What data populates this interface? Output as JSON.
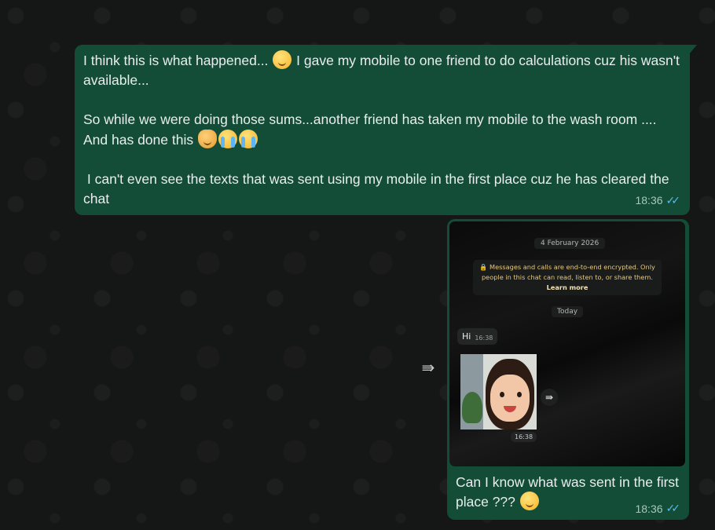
{
  "messages": [
    {
      "id": "msg1",
      "paragraphs": [
        "I think this is what happened... ",
        " I gave my mobile to one friend to do calculations cuz his wasn't available...",
        "So while we were doing those sums...another friend has taken my mobile to the wash room .... And has done this ",
        " I can't even see the texts that was sent using my mobile in the first place cuz he has cleared the chat"
      ],
      "time": "18:36",
      "status_icon": "double-check-read-icon"
    },
    {
      "id": "msg2",
      "attachment": {
        "date_chip": "4 February 2026",
        "encryption_notice": "Messages and calls are end-to-end encrypted. Only people in this chat can read, listen to, or share them.",
        "learn_more": "Learn more",
        "today_chip": "Today",
        "inner_message_text": "Hi",
        "inner_message_time": "16:38",
        "photo_time": "16:38"
      },
      "caption": "Can I know what was sent in the first place ??? ",
      "time": "18:36",
      "status_icon": "double-check-read-icon"
    }
  ],
  "colors": {
    "outgoing_bubble": "#144d37",
    "background": "#161717",
    "read_ticks": "#53bdeb"
  }
}
